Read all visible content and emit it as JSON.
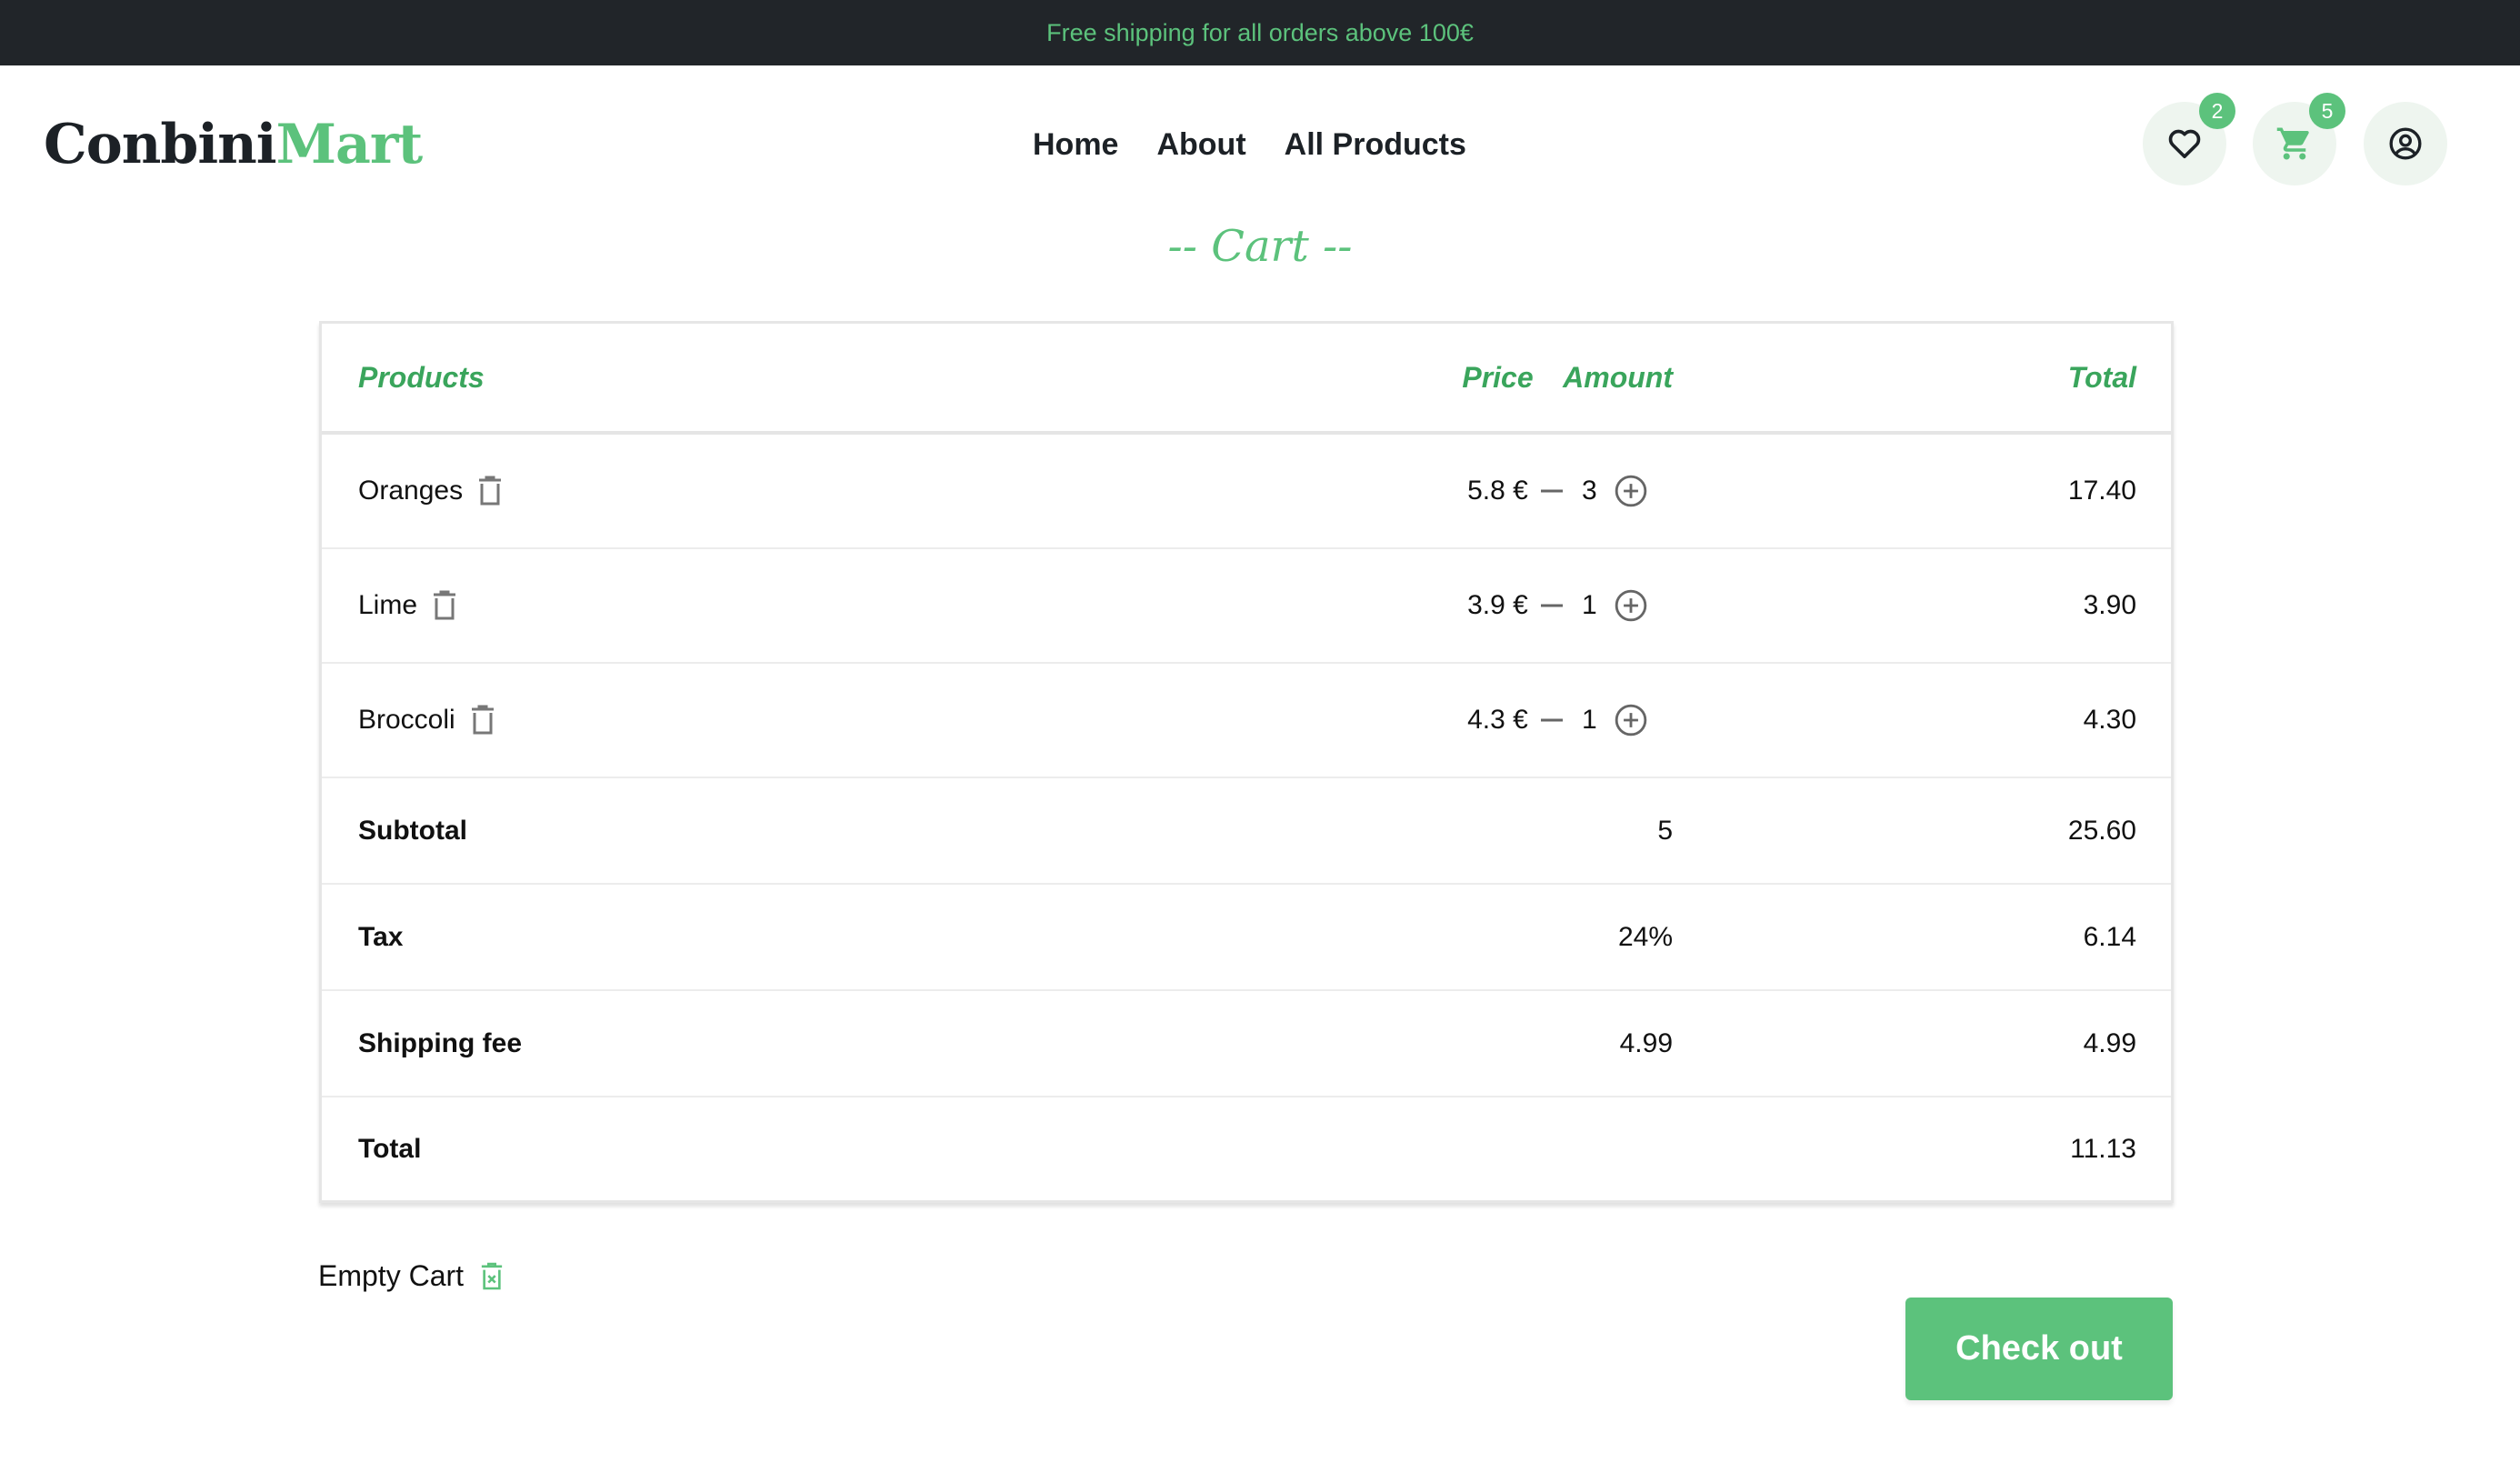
{
  "announcement": "Free shipping for all orders above 100€",
  "logo": {
    "part1": "Conbini",
    "part2": "Mart"
  },
  "nav": [
    {
      "label": "Home"
    },
    {
      "label": "About"
    },
    {
      "label": "All Products"
    }
  ],
  "header_icons": {
    "wishlist_count": "2",
    "cart_count": "5",
    "accent": "#5cc27c"
  },
  "title": "-- Cart --",
  "table": {
    "headers": {
      "products": "Products",
      "price": "Price",
      "amount": "Amount",
      "total": "Total"
    },
    "items": [
      {
        "name": "Oranges",
        "price": "5.8 €",
        "qty": "3",
        "total": "17.40"
      },
      {
        "name": "Lime",
        "price": "3.9 €",
        "qty": "1",
        "total": "3.90"
      },
      {
        "name": "Broccoli",
        "price": "4.3 €",
        "qty": "1",
        "total": "4.30"
      }
    ],
    "summary": [
      {
        "label": "Subtotal",
        "amount": "5",
        "total": "25.60"
      },
      {
        "label": "Tax",
        "amount": "24%",
        "total": "6.14"
      },
      {
        "label": "Shipping fee",
        "amount": "4.99",
        "total": "4.99"
      },
      {
        "label": "Total",
        "amount": "",
        "total": "11.13"
      }
    ]
  },
  "empty_cart_label": "Empty Cart",
  "checkout_label": "Check out"
}
